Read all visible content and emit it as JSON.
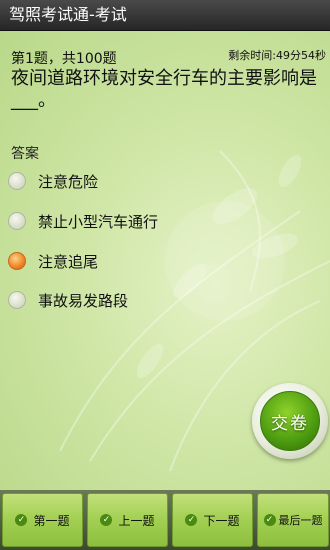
{
  "app": {
    "title": "驾照考试通-考试"
  },
  "exam": {
    "question_number": "第1题，共100题",
    "time_remaining": "剩余时间:49分54秒",
    "question_text": "夜间道路环境对安全行车的主要影响是___。",
    "answer_label": "答案",
    "options": [
      {
        "label": "注意危险",
        "selected": false
      },
      {
        "label": "禁止小型汽车通行",
        "selected": false
      },
      {
        "label": "注意追尾",
        "selected": true
      },
      {
        "label": "事故易发路段",
        "selected": false
      }
    ],
    "submit_label": "交卷"
  },
  "nav": {
    "buttons": [
      {
        "label": "第一题",
        "icon": "check-icon"
      },
      {
        "label": "上一题",
        "icon": "check-icon"
      },
      {
        "label": "下一题",
        "icon": "check-icon"
      },
      {
        "label": "最后一题",
        "icon": "check-icon"
      }
    ]
  },
  "colors": {
    "title_bar": "#333333",
    "background": "#c9e2a0",
    "selected_radio": "#f08a2a",
    "nav_button": "#a2cf52",
    "submit_button": "#4b9a10"
  }
}
